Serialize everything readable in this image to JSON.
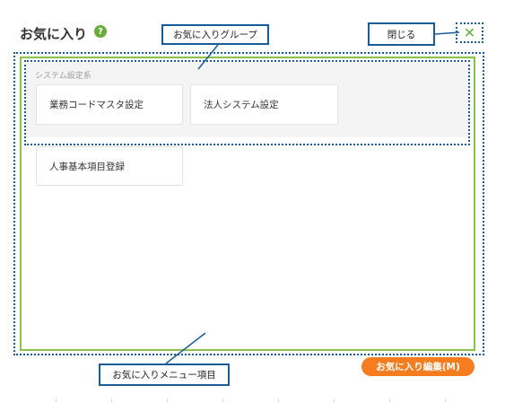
{
  "dialog": {
    "title": "お気に入り",
    "help_icon": "question-circle-icon",
    "help_glyph": "?",
    "close_icon": "close-x-icon",
    "close_glyph": "✕"
  },
  "groups": [
    {
      "label": "システム設定系",
      "items": [
        "業務コードマスタ設定",
        "法人システム設定"
      ]
    }
  ],
  "ungrouped_items": [
    "人事基本項目登録"
  ],
  "footer": {
    "edit_button_label": "お気に入り編集(M)"
  },
  "callouts": {
    "group": "お気に入りグループ",
    "close": "閉じる",
    "menu_item": "お気に入りメニュー項目"
  },
  "colors": {
    "accent_green": "#6aac3c",
    "panel_border": "#8bc34a",
    "callout_blue": "#1a5c9a",
    "edit_button": "#f57c1f"
  }
}
